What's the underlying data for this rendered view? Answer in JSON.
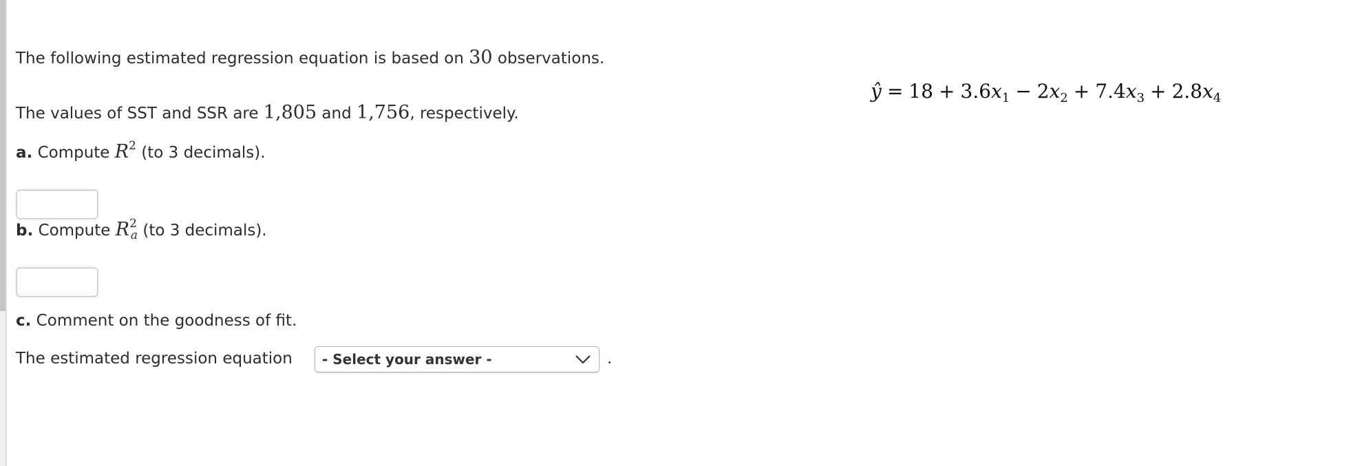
{
  "intro": {
    "text_before": "The following estimated regression equation is based on ",
    "observations": "30",
    "text_after": " observations."
  },
  "equation": {
    "lhs": "ŷ",
    "equals": "=",
    "intercept": "18",
    "terms": [
      {
        "sign": "+",
        "coef": "3.6",
        "var": "x",
        "sub": "1"
      },
      {
        "sign": "−",
        "coef": "2",
        "var": "x",
        "sub": "2"
      },
      {
        "sign": "+",
        "coef": "7.4",
        "var": "x",
        "sub": "3"
      },
      {
        "sign": "+",
        "coef": "2.8",
        "var": "x",
        "sub": "4"
      }
    ]
  },
  "sst_ssr": {
    "text1": "The values of SST and SSR are ",
    "sst": "1,805",
    "text2": " and ",
    "ssr": "1,756",
    "text3": ", respectively."
  },
  "part_a": {
    "label": "a.",
    "text_before": " Compute ",
    "symbol": "R",
    "sup": "2",
    "text_after": " (to 3 decimals).",
    "answer_value": ""
  },
  "part_b": {
    "label": "b.",
    "text_before": " Compute ",
    "symbol": "R",
    "sup": "2",
    "sub": "a",
    "text_after": " (to 3 decimals).",
    "answer_value": ""
  },
  "part_c": {
    "label": "c.",
    "text": " Comment on the goodness of fit.",
    "sentence_before": "The estimated regression equation",
    "select_value": "- Select your answer -",
    "sentence_after": "."
  }
}
